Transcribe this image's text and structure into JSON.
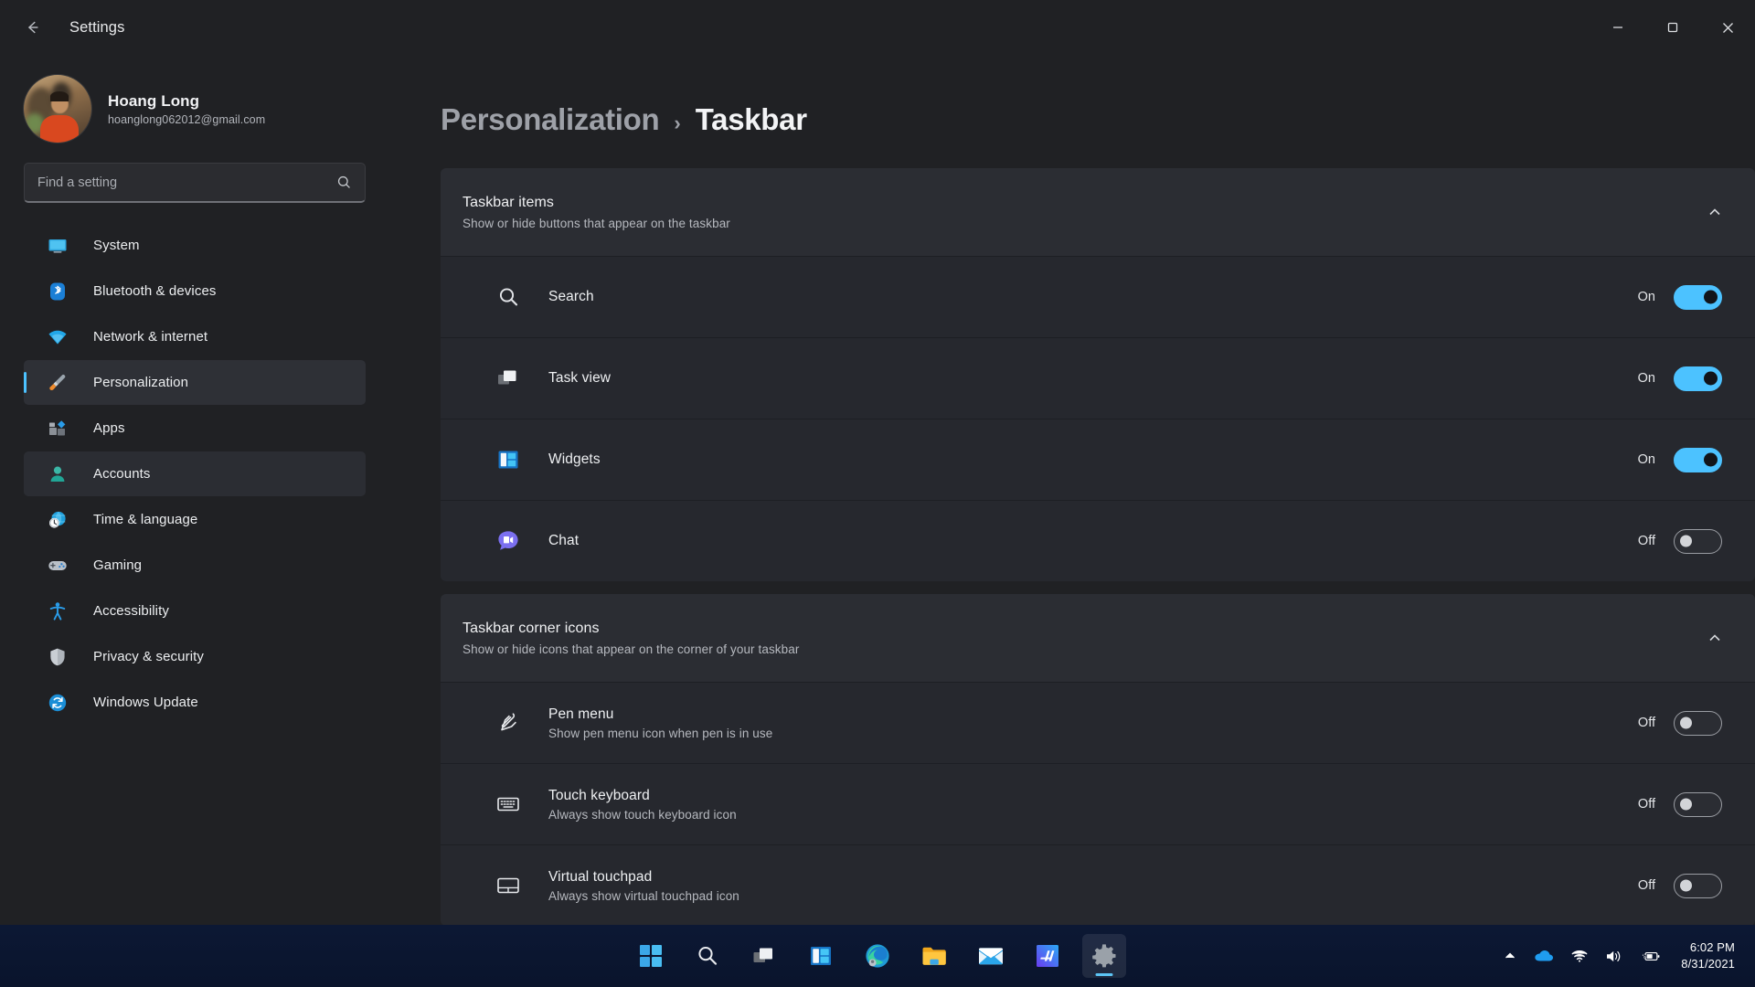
{
  "window": {
    "title": "Settings",
    "back_icon": "back-arrow-icon",
    "minimize_label": "Minimize",
    "maximize_label": "Maximize",
    "close_label": "Close"
  },
  "profile": {
    "name": "Hoang Long",
    "email": "hoanglong062012@gmail.com"
  },
  "search": {
    "placeholder": "Find a setting",
    "value": "",
    "icon": "search-icon"
  },
  "sidebar": {
    "items": [
      {
        "label": "System",
        "icon": "monitor-icon",
        "state": "normal"
      },
      {
        "label": "Bluetooth & devices",
        "icon": "bluetooth-icon",
        "state": "normal"
      },
      {
        "label": "Network & internet",
        "icon": "wifi-icon",
        "state": "normal"
      },
      {
        "label": "Personalization",
        "icon": "paintbrush-icon",
        "state": "active"
      },
      {
        "label": "Apps",
        "icon": "apps-icon",
        "state": "normal"
      },
      {
        "label": "Accounts",
        "icon": "person-icon",
        "state": "hovered"
      },
      {
        "label": "Time & language",
        "icon": "globe-clock-icon",
        "state": "normal"
      },
      {
        "label": "Gaming",
        "icon": "gamepad-icon",
        "state": "normal"
      },
      {
        "label": "Accessibility",
        "icon": "accessibility-icon",
        "state": "normal"
      },
      {
        "label": "Privacy & security",
        "icon": "shield-icon",
        "state": "normal"
      },
      {
        "label": "Windows Update",
        "icon": "update-icon",
        "state": "normal"
      }
    ]
  },
  "breadcrumb": {
    "parent": "Personalization",
    "separator": "›",
    "current": "Taskbar"
  },
  "sections": [
    {
      "title": "Taskbar items",
      "subtitle": "Show or hide buttons that appear on the taskbar",
      "expanded": true,
      "rows": [
        {
          "label": "Search",
          "desc": "",
          "icon": "search-icon",
          "state": "On",
          "on": true
        },
        {
          "label": "Task view",
          "desc": "",
          "icon": "taskview-icon",
          "state": "On",
          "on": true
        },
        {
          "label": "Widgets",
          "desc": "",
          "icon": "widgets-icon",
          "state": "On",
          "on": true
        },
        {
          "label": "Chat",
          "desc": "",
          "icon": "chat-icon",
          "state": "Off",
          "on": false
        }
      ]
    },
    {
      "title": "Taskbar corner icons",
      "subtitle": "Show or hide icons that appear on the corner of your taskbar",
      "expanded": true,
      "rows": [
        {
          "label": "Pen menu",
          "desc": "Show pen menu icon when pen is in use",
          "icon": "pen-icon",
          "state": "Off",
          "on": false
        },
        {
          "label": "Touch keyboard",
          "desc": "Always show touch keyboard icon",
          "icon": "keyboard-icon",
          "state": "Off",
          "on": false
        },
        {
          "label": "Virtual touchpad",
          "desc": "Always show virtual touchpad icon",
          "icon": "touchpad-icon",
          "state": "Off",
          "on": false
        }
      ]
    }
  ],
  "taskbar": {
    "apps": [
      {
        "name": "start-icon",
        "label": "Start"
      },
      {
        "name": "search-icon",
        "label": "Search"
      },
      {
        "name": "taskview-icon",
        "label": "Task view"
      },
      {
        "name": "widgets-icon",
        "label": "Widgets"
      },
      {
        "name": "edge-icon",
        "label": "Microsoft Edge"
      },
      {
        "name": "file-explorer-icon",
        "label": "File Explorer"
      },
      {
        "name": "mail-icon",
        "label": "Mail"
      },
      {
        "name": "store-icon",
        "label": "Microsoft Store"
      },
      {
        "name": "settings-icon",
        "label": "Settings"
      }
    ],
    "active_app": "settings-icon",
    "tray": [
      {
        "name": "chevron-up-icon",
        "label": "Show hidden icons"
      },
      {
        "name": "onedrive-icon",
        "label": "OneDrive"
      },
      {
        "name": "wifi-icon",
        "label": "Network"
      },
      {
        "name": "volume-icon",
        "label": "Volume"
      },
      {
        "name": "battery-icon",
        "label": "Battery charging"
      }
    ],
    "clock_time": "6:02 PM",
    "clock_date": "8/31/2021"
  },
  "colors": {
    "accent": "#4cc2ff",
    "taskbar_indicator": "#5cc4f5",
    "card_header_bg": "#2b2d33",
    "row_bg": "#26282e",
    "app_bg": "#202124"
  }
}
